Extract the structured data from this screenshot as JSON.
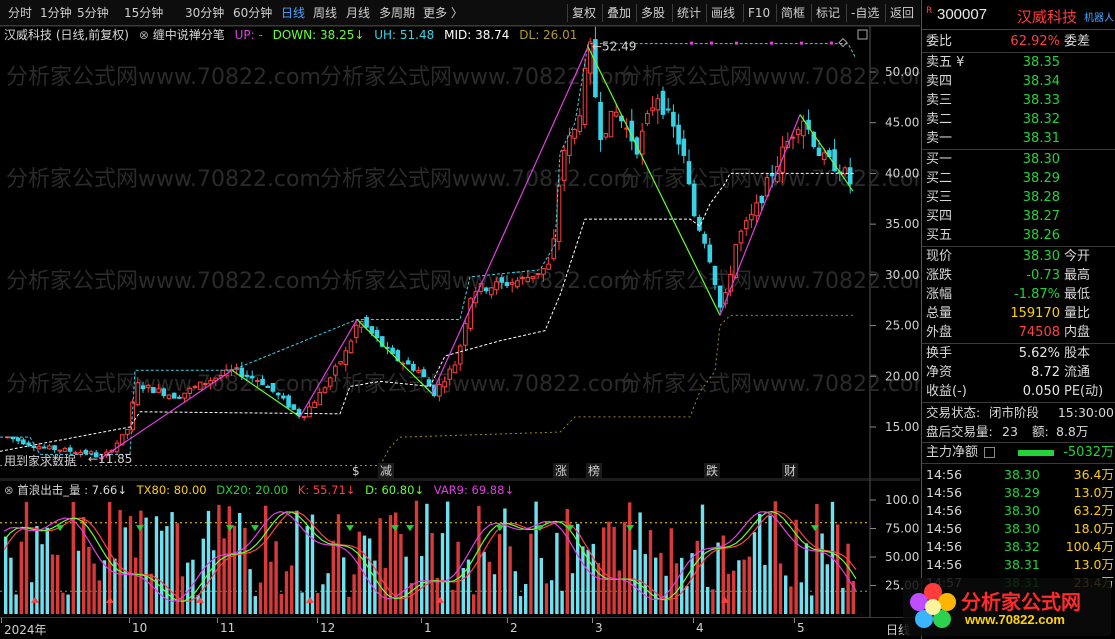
{
  "toolbar": {
    "periods": [
      "分时",
      "1分钟",
      "5分钟",
      "15分钟",
      "30分钟",
      "60分钟",
      "日线",
      "周线",
      "月线",
      "多周期",
      "更多 〉"
    ],
    "active_period": "日线",
    "tools": [
      "复权",
      "叠加",
      "多股",
      "统计",
      "画线",
      "F10",
      "简框",
      "标记",
      "-自选",
      "返回"
    ]
  },
  "chart_header": {
    "stock_label": "汉威科技 (日线,前复权)",
    "indicator": "缠中说禅分笔",
    "up_label": "UP: -",
    "down_label": "DOWN: 38.25↓",
    "uh_label": "UH: 51.48",
    "mid_label": "MID: 38.74",
    "dl_label": "DL: 26.01"
  },
  "price_axis": {
    "ticks": [
      "50.00",
      "45.00",
      "40.00",
      "35.00",
      "30.00",
      "25.00",
      "20.00",
      "15.00"
    ]
  },
  "annotations": {
    "high": "52.49",
    "low": "11.85",
    "bottom_left": "用到家求数据",
    "event_labels": [
      "减",
      "涨",
      "榜",
      "跌",
      "财"
    ],
    "event_marker": "$"
  },
  "indicator_header": {
    "name": "首浪出击_量 : 7.66↓",
    "tx80": "TX80: 80.00",
    "dx20": "DX20: 20.00",
    "k": "K: 55.71↓",
    "d": "D: 60.80↓",
    "var9": "VAR9: 69.88↓"
  },
  "indicator_axis": {
    "ticks": [
      "100.0",
      "75.00",
      "50.00",
      "25.00"
    ]
  },
  "x_axis": {
    "labels": [
      "2024年",
      "10",
      "11",
      "12",
      "1",
      "2",
      "3",
      "4",
      "5"
    ],
    "period_label": "日线"
  },
  "watermark": "分析家公式网www.70822.com",
  "quote": {
    "badge": "R",
    "code": "300007",
    "name": "汉威科技",
    "robot": "机器人",
    "weibi_label": "委比",
    "weibi": "62.92%",
    "weicha_label": "委差",
    "asks": [
      {
        "label": "卖五 ¥",
        "price": "38.35"
      },
      {
        "label": "卖四",
        "price": "38.34"
      },
      {
        "label": "卖三",
        "price": "38.33"
      },
      {
        "label": "卖二",
        "price": "38.32"
      },
      {
        "label": "卖一",
        "price": "38.31"
      }
    ],
    "bids": [
      {
        "label": "买一",
        "price": "38.30"
      },
      {
        "label": "买二",
        "price": "38.29"
      },
      {
        "label": "买三",
        "price": "38.28"
      },
      {
        "label": "买四",
        "price": "38.27"
      },
      {
        "label": "买五",
        "price": "38.26"
      }
    ],
    "stats": [
      {
        "label": "现价",
        "value": "38.30",
        "color": "green",
        "label2": "今开"
      },
      {
        "label": "涨跌",
        "value": "-0.73",
        "color": "green",
        "label2": "最高"
      },
      {
        "label": "涨幅",
        "value": "-1.87%",
        "color": "green",
        "label2": "最低"
      },
      {
        "label": "总量",
        "value": "159170",
        "color": "yellow",
        "label2": "量比"
      },
      {
        "label": "外盘",
        "value": "74508",
        "color": "red",
        "label2": "内盘"
      }
    ],
    "stats2": [
      {
        "label": "换手",
        "value": "5.62%",
        "label2": "股本"
      },
      {
        "label": "净资",
        "value": "8.72",
        "label2": "流通"
      },
      {
        "label": "收益(-)",
        "value": "0.050",
        "label2": "PE(动)"
      }
    ],
    "status_label": "交易状态:",
    "status_value": "闭市阶段",
    "status_time": "15:30:00",
    "after_label": "盘后交易量:",
    "after_volume": "23",
    "amount_label": "额:",
    "amount_value": "8.8万",
    "mainflow_label": "主力净额",
    "mainflow_value": "-5032万",
    "ticks": [
      {
        "time": "14:56",
        "price": "38.30",
        "vol": "36.4万",
        "color": "green"
      },
      {
        "time": "14:56",
        "price": "38.29",
        "vol": "13.0万",
        "color": "green"
      },
      {
        "time": "14:56",
        "price": "38.30",
        "vol": "63.2万",
        "color": "green"
      },
      {
        "time": "14:56",
        "price": "38.30",
        "vol": "18.0万",
        "color": "green"
      },
      {
        "time": "14:56",
        "price": "38.32",
        "vol": "100.4万",
        "color": "green"
      },
      {
        "time": "14:56",
        "price": "38.31",
        "vol": "13.0万",
        "color": "green"
      },
      {
        "time": "14:57",
        "price": "38.31",
        "vol": "23.4万",
        "color": "green"
      }
    ]
  },
  "logo": {
    "text": "分析家公式网",
    "url": "www.70822.com"
  },
  "colors": {
    "up": "#ff4040",
    "down": "#36d3e6",
    "magenta": "#e040e0",
    "lime": "#66ff33",
    "white_dash": "#ffffff",
    "cyan_dash": "#36d3e6",
    "olive_dash": "#a08a20"
  },
  "chart_data": {
    "type": "candlestick",
    "y_range": [
      11,
      54
    ],
    "key_points": [
      {
        "label": "low",
        "value": 11.85
      },
      {
        "label": "high",
        "value": 52.49
      }
    ],
    "bi_stroke_values": [
      11.85,
      20.6,
      16.0,
      25.6,
      18.3,
      52.49,
      26.01,
      45.8,
      38.25
    ],
    "channel_lines": {
      "UH": 51.48,
      "MID": 38.74,
      "DL": 26.01
    },
    "indicator": {
      "name": "首浪出击_量",
      "y_range": [
        0,
        105
      ],
      "levels": {
        "TX80": 80.0,
        "DX20": 20.0
      },
      "last": {
        "K": 55.71,
        "D": 60.8,
        "VAR9": 69.88
      }
    }
  }
}
